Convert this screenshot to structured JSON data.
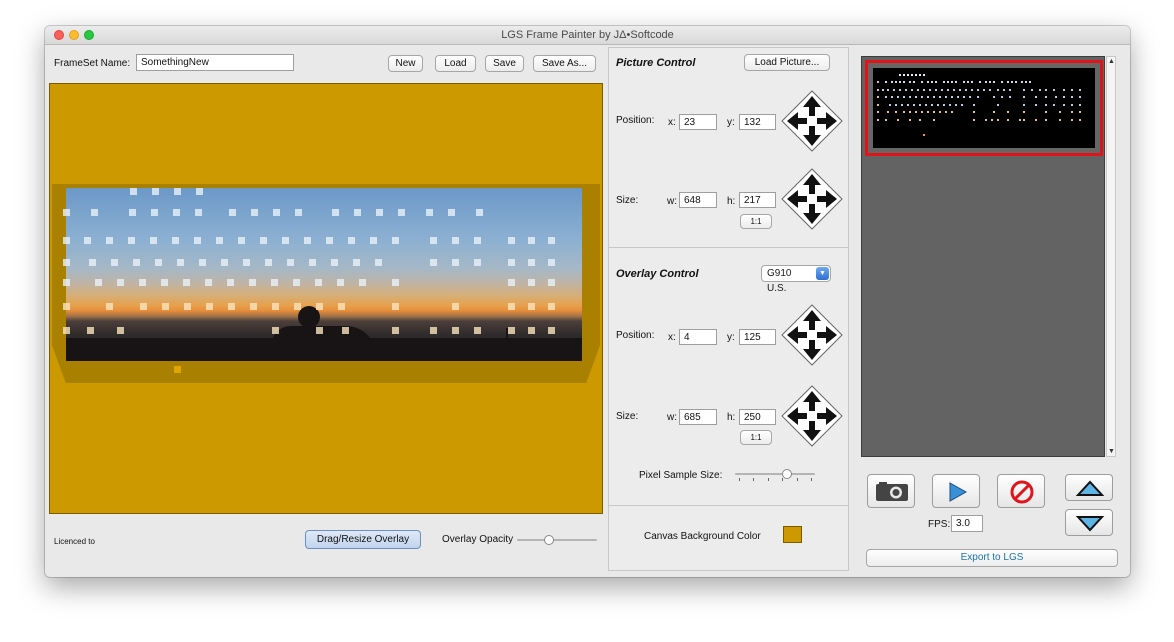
{
  "window": {
    "title": "LGS Frame Painter by JΔ•Softcode"
  },
  "frameset": {
    "label": "FrameSet Name:",
    "value": "SomethingNew"
  },
  "toolbar": {
    "new_label": "New",
    "load_label": "Load",
    "save_label": "Save",
    "save_as_label": "Save As..."
  },
  "footer": {
    "licence_label": "Licenced to",
    "drag_resize_label": "Drag/Resize Overlay",
    "opacity_label": "Overlay Opacity",
    "opacity_value": 0.4
  },
  "picture_control": {
    "heading": "Picture Control",
    "load_picture_label": "Load Picture...",
    "position_label": "Position:",
    "x_label": "x:",
    "x_value": "23",
    "y_label": "y:",
    "y_value": "132",
    "size_label": "Size:",
    "w_label": "w:",
    "w_value": "648",
    "h_label": "h:",
    "h_value": "217",
    "ratio_label": "1:1"
  },
  "overlay_control": {
    "heading": "Overlay Control",
    "keyboard_selected": "G910 U.S.",
    "position_label": "Position:",
    "x_label": "x:",
    "x_value": "4",
    "y_label": "y:",
    "y_value": "125",
    "size_label": "Size:",
    "w_label": "w:",
    "w_value": "685",
    "h_label": "h:",
    "h_value": "250",
    "ratio_label": "1:1",
    "pixel_sample_label": "Pixel Sample Size:",
    "pixel_sample_value": 0.65
  },
  "canvas_bg": {
    "label": "Canvas Background Color",
    "color": "#cc9a00"
  },
  "playback": {
    "fps_label": "FPS:",
    "fps_value": "3.0",
    "export_label": "Export to LGS"
  },
  "icons": {
    "camera": "camera-icon",
    "play": "play-icon",
    "stop": "stop-icon",
    "up": "triangle-up-icon",
    "down": "triangle-down-icon",
    "arrows": "four-way-arrow-icon"
  },
  "colors": {
    "canvas": "#cc9a00",
    "overlay": "#aa8000",
    "selection": "#e0141a",
    "accent": "#2f6fd0"
  }
}
